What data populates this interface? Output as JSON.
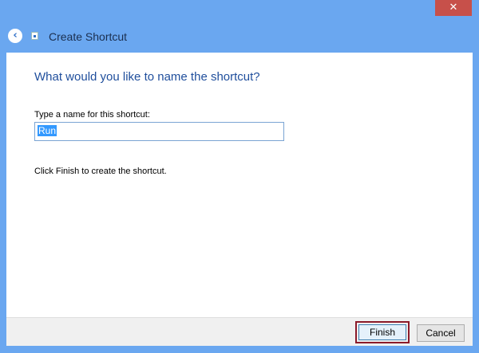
{
  "window": {
    "close_glyph": "✕"
  },
  "header": {
    "back_glyph": "🡐",
    "title": "Create Shortcut"
  },
  "main": {
    "heading": "What would you like to name the shortcut?",
    "name_label": "Type a name for this shortcut:",
    "name_value": "Run",
    "info_text": "Click Finish to create the shortcut."
  },
  "footer": {
    "finish_label": "Finish",
    "cancel_label": "Cancel"
  },
  "icons": {
    "back": "back-arrow-icon",
    "close": "close-icon",
    "shortcut": "shortcut-icon"
  },
  "colors": {
    "titlebar": "#6aa7f0",
    "close": "#c7504a",
    "heading": "#1f4e9c",
    "selection": "#3399ff",
    "finish_focus_outline": "#8b1a2a"
  }
}
